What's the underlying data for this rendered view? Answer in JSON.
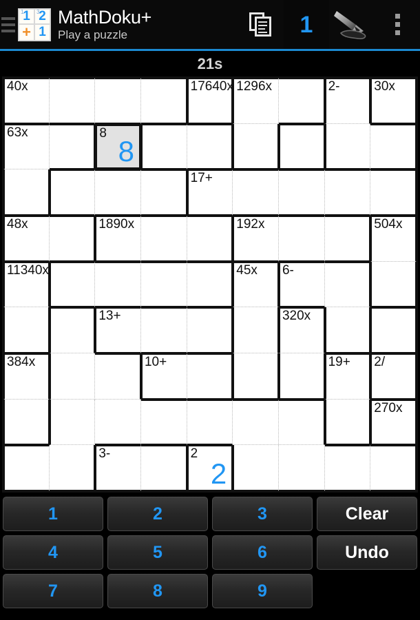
{
  "app": {
    "title": "MathDoku+",
    "subtitle": "Play a puzzle",
    "logo_cells": [
      "1",
      "2",
      "+",
      "1"
    ],
    "logo_superscripts": [
      "1",
      "3",
      "",
      ""
    ],
    "accent_color": "#2196f3",
    "accent_underline": "#1c8ad1"
  },
  "actionbar": {
    "drawer_icon": "menu-icon",
    "actions": [
      {
        "name": "copy-puzzle",
        "icon": "copy-pages-icon",
        "label": "",
        "selected": false
      },
      {
        "name": "digit-mode",
        "icon": "digit-one-icon",
        "label": "1",
        "selected": true
      },
      {
        "name": "pen-mode",
        "icon": "pen-icon",
        "label": "",
        "selected": false
      },
      {
        "name": "overflow-menu",
        "icon": "overflow-dots-icon",
        "label": "",
        "selected": false
      }
    ]
  },
  "timer": {
    "label": "21s"
  },
  "grid": {
    "size": 9,
    "selected_cell": {
      "row": 2,
      "col": 3
    },
    "cages": [
      {
        "id": 1,
        "label": "40x",
        "cells": [
          [
            1,
            1
          ],
          [
            1,
            2
          ],
          [
            1,
            3
          ],
          [
            1,
            4
          ]
        ]
      },
      {
        "id": 2,
        "label": "17640x",
        "cells": [
          [
            1,
            5
          ]
        ]
      },
      {
        "id": 3,
        "label": "1296x",
        "cells": [
          [
            1,
            6
          ],
          [
            1,
            7
          ],
          [
            2,
            6
          ]
        ]
      },
      {
        "id": 4,
        "label": "2-",
        "cells": [
          [
            1,
            8
          ],
          [
            2,
            8
          ],
          [
            2,
            9
          ]
        ]
      },
      {
        "id": 5,
        "label": "30x",
        "cells": [
          [
            1,
            9
          ]
        ]
      },
      {
        "id": 6,
        "label": "63x",
        "cells": [
          [
            2,
            1
          ],
          [
            3,
            1
          ],
          [
            2,
            2
          ]
        ]
      },
      {
        "id": 7,
        "label": "8",
        "cells": [
          [
            2,
            3
          ]
        ]
      },
      {
        "id": 8,
        "label": "",
        "cells": [
          [
            2,
            4
          ],
          [
            2,
            5
          ],
          [
            2,
            7
          ]
        ]
      },
      {
        "id": 9,
        "label": "17+",
        "cells": [
          [
            3,
            5
          ],
          [
            3,
            6
          ],
          [
            3,
            7
          ],
          [
            3,
            8
          ],
          [
            3,
            9
          ]
        ]
      },
      {
        "id": 10,
        "label": "",
        "cells": [
          [
            3,
            2
          ],
          [
            3,
            3
          ],
          [
            3,
            4
          ]
        ]
      },
      {
        "id": 11,
        "label": "48x",
        "cells": [
          [
            4,
            1
          ],
          [
            4,
            2
          ]
        ]
      },
      {
        "id": 12,
        "label": "1890x",
        "cells": [
          [
            4,
            3
          ],
          [
            4,
            4
          ],
          [
            4,
            5
          ]
        ]
      },
      {
        "id": 13,
        "label": "192x",
        "cells": [
          [
            4,
            6
          ],
          [
            4,
            7
          ],
          [
            4,
            8
          ]
        ]
      },
      {
        "id": 14,
        "label": "504x",
        "cells": [
          [
            4,
            9
          ],
          [
            5,
            9
          ]
        ]
      },
      {
        "id": 15,
        "label": "11340x",
        "cells": [
          [
            5,
            1
          ],
          [
            6,
            1
          ]
        ]
      },
      {
        "id": 16,
        "label": "",
        "cells": [
          [
            5,
            2
          ],
          [
            5,
            3
          ],
          [
            5,
            4
          ],
          [
            5,
            5
          ]
        ]
      },
      {
        "id": 17,
        "label": "45x",
        "cells": [
          [
            5,
            6
          ],
          [
            6,
            6
          ],
          [
            7,
            6
          ]
        ]
      },
      {
        "id": 18,
        "label": "6-",
        "cells": [
          [
            5,
            7
          ],
          [
            5,
            8
          ],
          [
            6,
            8
          ]
        ]
      },
      {
        "id": 19,
        "label": "13+",
        "cells": [
          [
            6,
            3
          ],
          [
            6,
            4
          ],
          [
            6,
            5
          ]
        ]
      },
      {
        "id": 20,
        "label": "320x",
        "cells": [
          [
            6,
            7
          ],
          [
            7,
            7
          ]
        ]
      },
      {
        "id": 21,
        "label": "384x",
        "cells": [
          [
            7,
            1
          ],
          [
            8,
            1
          ]
        ]
      },
      {
        "id": 22,
        "label": "10+",
        "cells": [
          [
            7,
            4
          ],
          [
            7,
            5
          ]
        ]
      },
      {
        "id": 23,
        "label": "19+",
        "cells": [
          [
            7,
            8
          ],
          [
            8,
            8
          ]
        ]
      },
      {
        "id": 24,
        "label": "2/",
        "cells": [
          [
            7,
            9
          ]
        ]
      },
      {
        "id": 25,
        "label": "270x",
        "cells": [
          [
            8,
            9
          ]
        ]
      },
      {
        "id": 26,
        "label": "3-",
        "cells": [
          [
            9,
            3
          ],
          [
            9,
            4
          ]
        ]
      },
      {
        "id": 27,
        "label": "2",
        "cells": [
          [
            9,
            5
          ]
        ]
      }
    ],
    "entries": [
      {
        "row": 2,
        "col": 3,
        "value": "8"
      },
      {
        "row": 9,
        "col": 5,
        "value": "2"
      }
    ]
  },
  "keypad": {
    "keys": [
      {
        "label": "1",
        "kind": "digit"
      },
      {
        "label": "2",
        "kind": "digit"
      },
      {
        "label": "3",
        "kind": "digit"
      },
      {
        "label": "Clear",
        "kind": "word"
      },
      {
        "label": "4",
        "kind": "digit"
      },
      {
        "label": "5",
        "kind": "digit"
      },
      {
        "label": "6",
        "kind": "digit"
      },
      {
        "label": "Undo",
        "kind": "word"
      },
      {
        "label": "7",
        "kind": "digit"
      },
      {
        "label": "8",
        "kind": "digit"
      },
      {
        "label": "9",
        "kind": "digit"
      },
      {
        "label": "",
        "kind": "empty"
      }
    ]
  }
}
